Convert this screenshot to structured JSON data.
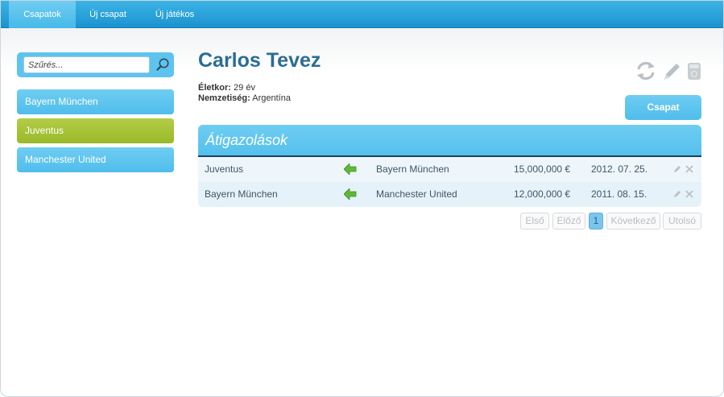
{
  "nav": {
    "tabs": [
      {
        "label": "Csapatok"
      },
      {
        "label": "Új csapat"
      },
      {
        "label": "Új játékos"
      }
    ]
  },
  "sidebar": {
    "search_placeholder": "Szűrés...",
    "teams": [
      {
        "label": "Bayern München",
        "selected": false
      },
      {
        "label": "Juventus",
        "selected": true
      },
      {
        "label": "Manchester United",
        "selected": false
      }
    ]
  },
  "player": {
    "name": "Carlos Tevez",
    "age_label": "Életkor:",
    "age_value": "29 év",
    "nationality_label": "Nemzetiség:",
    "nationality_value": "Argentína"
  },
  "toolbar": {
    "icons": [
      "refresh-icon",
      "pencil-icon",
      "trash-icon"
    ],
    "team_button": "Csapat"
  },
  "transfers": {
    "title": "Átigazolások",
    "rows": [
      {
        "from": "Juventus",
        "to": "Bayern München",
        "fee": "15,000,000 €",
        "date": "2012. 07. 25."
      },
      {
        "from": "Bayern München",
        "to": "Manchester United",
        "fee": "12,000,000 €",
        "date": "2011. 08. 15."
      }
    ]
  },
  "pager": {
    "first": "Első",
    "prev": "Előző",
    "current": "1",
    "next": "Következő",
    "last": "Utolsó"
  },
  "colors": {
    "nav_blue": "#1c93cf",
    "item_blue": "#5ec3ef",
    "selected_green": "#9aba2a",
    "title_blue": "#2a6d93"
  }
}
